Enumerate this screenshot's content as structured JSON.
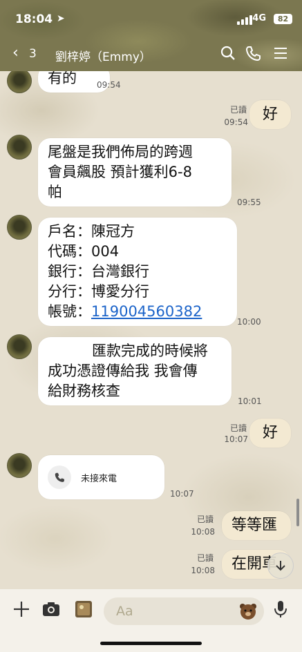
{
  "status_bar": {
    "time": "18:04",
    "network": "4G",
    "battery": "82"
  },
  "header": {
    "back_count": "3",
    "title": "劉梓婷（Emmy）"
  },
  "messages": {
    "m0": {
      "text": "有的",
      "time": "09:54"
    },
    "m1": {
      "read": "已讀",
      "time": "09:54",
      "text": "好"
    },
    "m2": {
      "lines": [
        "尾盤是我們佈局的跨週",
        "會員飆股 預計獲利6-8",
        "帕"
      ],
      "time": "09:55"
    },
    "m3": {
      "lines": [
        "戶名：陳冠方",
        "代碼：004",
        "銀行：台灣銀行",
        "分行：博愛分行"
      ],
      "account_label": "帳號：",
      "account_number": "119004560382",
      "time": "10:00"
    },
    "m4": {
      "lines": [
        "匯款完成的時候將",
        "成功憑證傳給我 我會傳",
        "給財務核查"
      ],
      "time": "10:01"
    },
    "m5": {
      "read": "已讀",
      "time": "10:07",
      "text": "好"
    },
    "m6": {
      "call_label": "未接來電",
      "time": "10:07"
    },
    "m7": {
      "read": "已讀",
      "time": "10:08",
      "text": "等等匯"
    },
    "m8": {
      "read": "已讀",
      "time": "10:08",
      "text": "在開車"
    }
  },
  "input": {
    "placeholder": "Aa"
  },
  "icons": {
    "back": "chevron-left-icon",
    "search": "search-icon",
    "phone": "phone-icon",
    "menu": "menu-icon",
    "plus": "plus-icon",
    "camera": "camera-icon",
    "photo": "photo-icon",
    "emoji": "bear-emoji-icon",
    "mic": "microphone-icon",
    "scroll": "arrow-down-icon"
  }
}
